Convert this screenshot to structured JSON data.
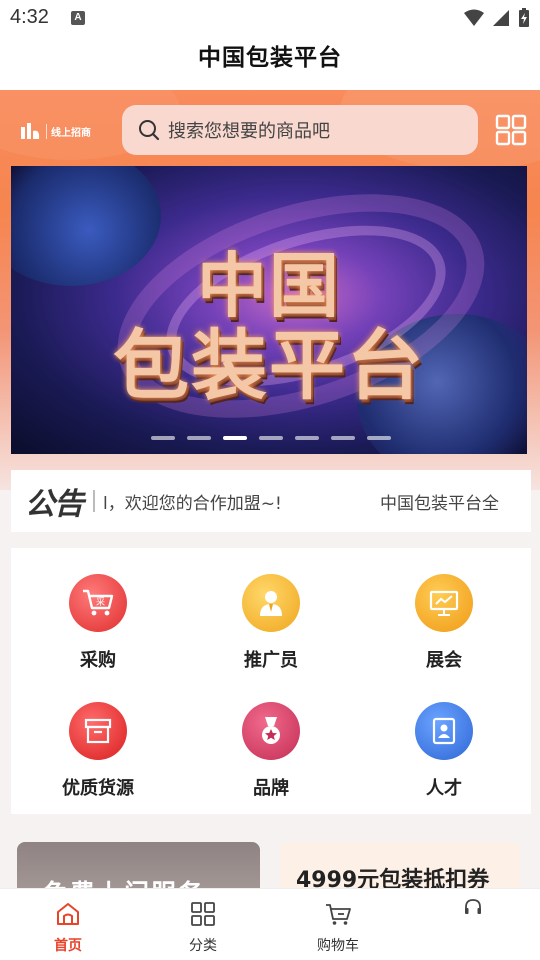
{
  "status_bar": {
    "time": "4:32",
    "indicator": "A"
  },
  "header": {
    "title": "中国包装平台"
  },
  "logo": {
    "text": "线上招商"
  },
  "search": {
    "placeholder": "搜索您想要的商品吧"
  },
  "banner": {
    "line1": "中国",
    "line2": "包装平台",
    "slide_count": 7,
    "active_slide": 3
  },
  "notice": {
    "logo": "公告",
    "text": "l，欢迎您的合作加盟~!",
    "text2": "中国包装平台全"
  },
  "categories": [
    {
      "label": "采购",
      "icon": "cart-icon",
      "color": "#ea3f3f"
    },
    {
      "label": "推广员",
      "icon": "promoter-icon",
      "color": "#f2b12c"
    },
    {
      "label": "展会",
      "icon": "exhibition-icon",
      "color": "#f3a622"
    },
    {
      "label": "优质货源",
      "icon": "box-icon",
      "color": "#e32a2a"
    },
    {
      "label": "品牌",
      "icon": "medal-icon",
      "color": "#d8416a"
    },
    {
      "label": "人才",
      "icon": "talent-icon",
      "color": "#3b78e0"
    }
  ],
  "promos": {
    "left": "免费上门服务",
    "right": "4999元包装抵扣券"
  },
  "tabbar": [
    {
      "label": "首页",
      "icon": "home-icon"
    },
    {
      "label": "分类",
      "icon": "category-icon"
    },
    {
      "label": "购物车",
      "icon": "cart-icon"
    },
    {
      "label": "",
      "icon": "headset-icon"
    }
  ],
  "colors": {
    "accent": "#e8442a",
    "header_orange": "#f6854f"
  }
}
